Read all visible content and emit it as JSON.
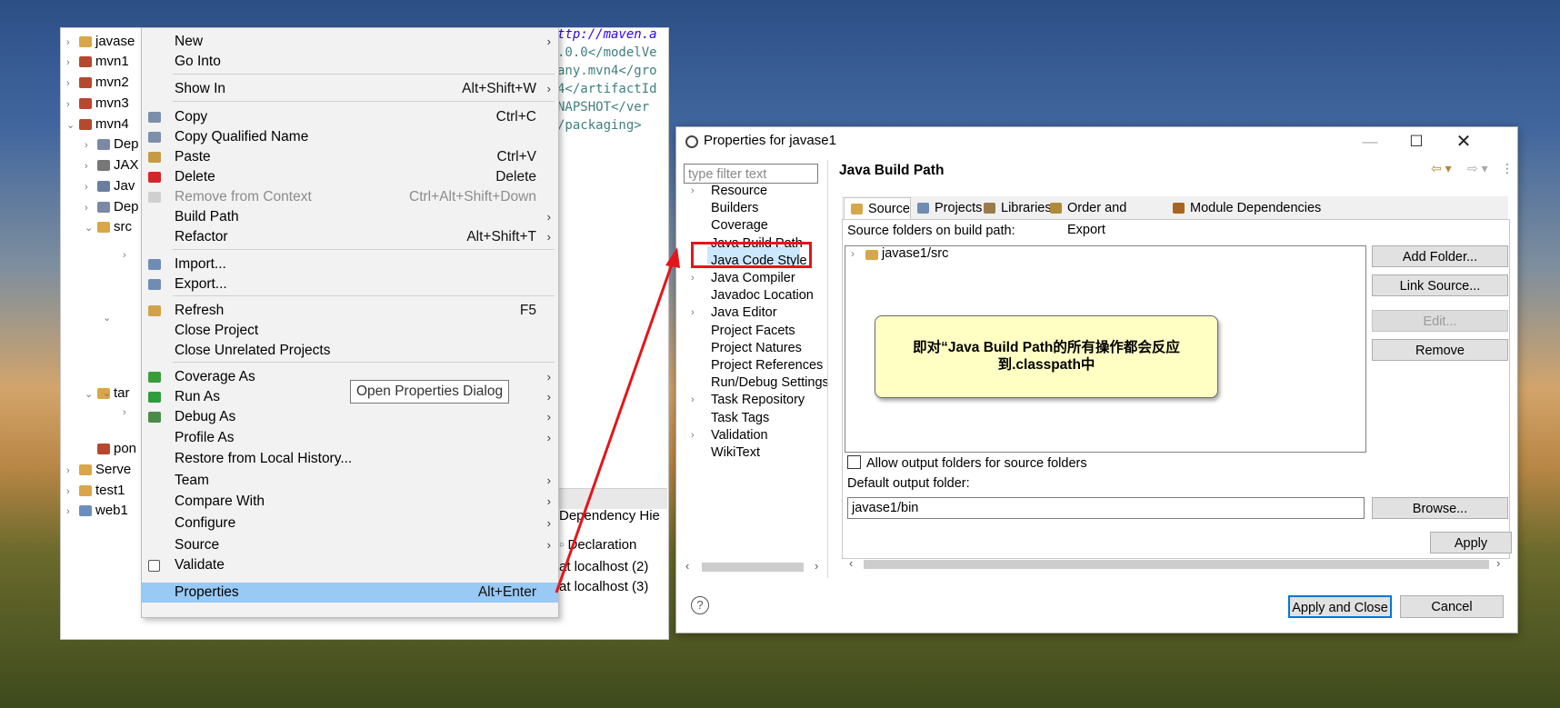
{
  "workspace": {
    "tree": [
      {
        "label": "javase",
        "twisty": "›"
      },
      {
        "label": "mvn1",
        "twisty": "›"
      },
      {
        "label": "mvn2",
        "twisty": "›"
      },
      {
        "label": "mvn3",
        "twisty": "›"
      },
      {
        "label": "mvn4",
        "twisty": "⌄"
      },
      {
        "label": "Dep",
        "twisty": "›"
      },
      {
        "label": "JAX",
        "twisty": "›"
      },
      {
        "label": "Jav",
        "twisty": "›"
      },
      {
        "label": "Dep",
        "twisty": "›"
      },
      {
        "label": "src",
        "twisty": "⌄"
      },
      {
        "label": "tar",
        "twisty": "⌄"
      },
      {
        "label": "pon",
        "twisty": ""
      },
      {
        "label": "Serve",
        "twisty": "›"
      },
      {
        "label": "test1",
        "twisty": "›"
      },
      {
        "label": "web1",
        "twisty": "›"
      }
    ],
    "code_lines": [
      "ttp://maven.a",
      ".0.0</modelVe",
      "any.mvn4</gro",
      "4</artifactId",
      "NAPSHOT</ver",
      "/packaging>"
    ],
    "bottom_tab": "Dependency Hie",
    "bottom_col": "Declaration",
    "bottom_rows": [
      "at localhost (2)",
      "at localhost (3)"
    ]
  },
  "menu": {
    "items": [
      {
        "label": "New",
        "accel": "",
        "arrow": "›",
        "icon": "",
        "color": ""
      },
      {
        "label": "Go Into",
        "accel": "",
        "arrow": "",
        "icon": "",
        "color": ""
      },
      {
        "label": "Show In",
        "accel": "Alt+Shift+W",
        "arrow": "›",
        "icon": "",
        "color": ""
      },
      {
        "label": "Copy",
        "accel": "Ctrl+C",
        "arrow": "",
        "icon": "copy-icon",
        "color": "#7b8fa8"
      },
      {
        "label": "Copy Qualified Name",
        "accel": "",
        "arrow": "",
        "icon": "copy-qualified-icon",
        "color": "#7b8fa8"
      },
      {
        "label": "Paste",
        "accel": "Ctrl+V",
        "arrow": "",
        "icon": "paste-icon",
        "color": "#c59a45"
      },
      {
        "label": "Delete",
        "accel": "Delete",
        "arrow": "",
        "icon": "delete-icon",
        "color": "#d3252b"
      },
      {
        "label": "Remove from Context",
        "accel": "Ctrl+Alt+Shift+Down",
        "arrow": "",
        "icon": "remove-context-icon",
        "color": "#cfcfcf"
      },
      {
        "label": "Build Path",
        "accel": "",
        "arrow": "›",
        "icon": "",
        "color": ""
      },
      {
        "label": "Refactor",
        "accel": "Alt+Shift+T",
        "arrow": "›",
        "icon": "",
        "color": ""
      },
      {
        "label": "Import...",
        "accel": "",
        "arrow": "",
        "icon": "import-icon",
        "color": "#6f8db3"
      },
      {
        "label": "Export...",
        "accel": "",
        "arrow": "",
        "icon": "export-icon",
        "color": "#6f8db3"
      },
      {
        "label": "Refresh",
        "accel": "F5",
        "arrow": "",
        "icon": "refresh-icon",
        "color": "#d0a34a"
      },
      {
        "label": "Close Project",
        "accel": "",
        "arrow": "",
        "icon": "",
        "color": ""
      },
      {
        "label": "Close Unrelated Projects",
        "accel": "",
        "arrow": "",
        "icon": "",
        "color": ""
      },
      {
        "label": "Coverage As",
        "accel": "",
        "arrow": "›",
        "icon": "coverage-icon",
        "color": "#3a9b3a"
      },
      {
        "label": "Run As",
        "accel": "",
        "arrow": "›",
        "icon": "run-icon",
        "color": "#2e9b3e"
      },
      {
        "label": "Debug As",
        "accel": "",
        "arrow": "›",
        "icon": "debug-icon",
        "color": "#4a8a4a"
      },
      {
        "label": "Profile As",
        "accel": "",
        "arrow": "›",
        "icon": "",
        "color": ""
      },
      {
        "label": "Restore from Local History...",
        "accel": "",
        "arrow": "",
        "icon": "",
        "color": ""
      },
      {
        "label": "Team",
        "accel": "",
        "arrow": "›",
        "icon": "",
        "color": ""
      },
      {
        "label": "Compare With",
        "accel": "",
        "arrow": "›",
        "icon": "",
        "color": ""
      },
      {
        "label": "Configure",
        "accel": "",
        "arrow": "›",
        "icon": "",
        "color": ""
      },
      {
        "label": "Source",
        "accel": "",
        "arrow": "›",
        "icon": "",
        "color": ""
      },
      {
        "label": "Validate",
        "accel": "",
        "arrow": "",
        "icon": "validate-check-icon",
        "color": "#ffffff"
      },
      {
        "label": "Properties",
        "accel": "Alt+Enter",
        "arrow": "",
        "icon": "",
        "color": ""
      }
    ],
    "tooltip": "Open Properties Dialog"
  },
  "dialog": {
    "title": "Properties for javase1",
    "filter_placeholder": "type filter text",
    "nav": [
      {
        "label": "Resource",
        "twisty": "›"
      },
      {
        "label": "Builders",
        "twisty": ""
      },
      {
        "label": "Coverage",
        "twisty": ""
      },
      {
        "label": "Java Build Path",
        "twisty": ""
      },
      {
        "label": "Java Code Style",
        "twisty": "›"
      },
      {
        "label": "Java Compiler",
        "twisty": "›"
      },
      {
        "label": "Javadoc Location",
        "twisty": ""
      },
      {
        "label": "Java Editor",
        "twisty": "›"
      },
      {
        "label": "Project Facets",
        "twisty": ""
      },
      {
        "label": "Project Natures",
        "twisty": ""
      },
      {
        "label": "Project References",
        "twisty": ""
      },
      {
        "label": "Run/Debug Settings",
        "twisty": ""
      },
      {
        "label": "Task Repository",
        "twisty": "›"
      },
      {
        "label": "Task Tags",
        "twisty": ""
      },
      {
        "label": "Validation",
        "twisty": "›"
      },
      {
        "label": "WikiText",
        "twisty": ""
      }
    ],
    "pane_title": "Java Build Path",
    "tabs": [
      {
        "label": "Source",
        "icon": "source-folder-icon"
      },
      {
        "label": "Projects",
        "icon": "projects-icon"
      },
      {
        "label": "Libraries",
        "icon": "libraries-icon"
      },
      {
        "label": "Order and Export",
        "icon": "order-export-icon"
      },
      {
        "label": "Module Dependencies",
        "icon": "module-icon"
      }
    ],
    "source_label": "Source folders on build path:",
    "source_entry": "javase1/src",
    "buttons": {
      "add_folder": "Add Folder...",
      "link_source": "Link Source...",
      "edit": "Edit...",
      "remove": "Remove",
      "browse": "Browse...",
      "apply": "Apply",
      "apply_close": "Apply and Close",
      "cancel": "Cancel"
    },
    "allow_output_label": "Allow output folders for source folders",
    "default_output_label": "Default output folder:",
    "default_output_value": "javase1/bin",
    "callout": "即对“Java Build Path的所有操作都会反应到.classpath中"
  },
  "colors": {
    "annotation_red": "#e3161b",
    "selection_blue": "#99c9f5"
  }
}
